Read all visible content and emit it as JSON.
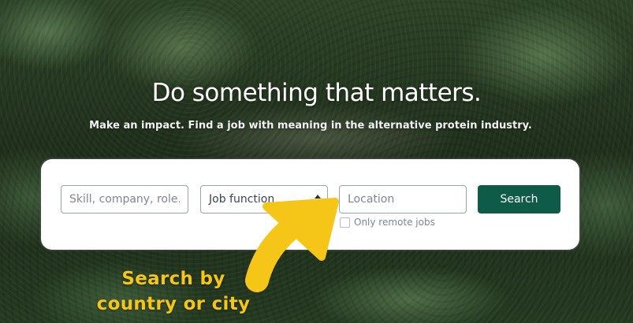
{
  "hero": {
    "title": "Do something that matters.",
    "subtitle": "Make an impact. Find a job with meaning in the alternative protein industry."
  },
  "search": {
    "skill_placeholder": "Skill, company, role...",
    "job_function_value": "Job function",
    "location_placeholder": "Location",
    "search_button": "Search",
    "remote_label": "Only remote jobs",
    "remote_checked": false
  },
  "annotation": {
    "line1": "Search by",
    "line2": "country or city",
    "color": "#f5c518"
  },
  "colors": {
    "primary_button": "#0e5c48",
    "annotation_yellow": "#f5c518"
  },
  "icons": {
    "select_indicator": "sort-arrows-icon",
    "annotation_arrow": "arrow-icon"
  }
}
